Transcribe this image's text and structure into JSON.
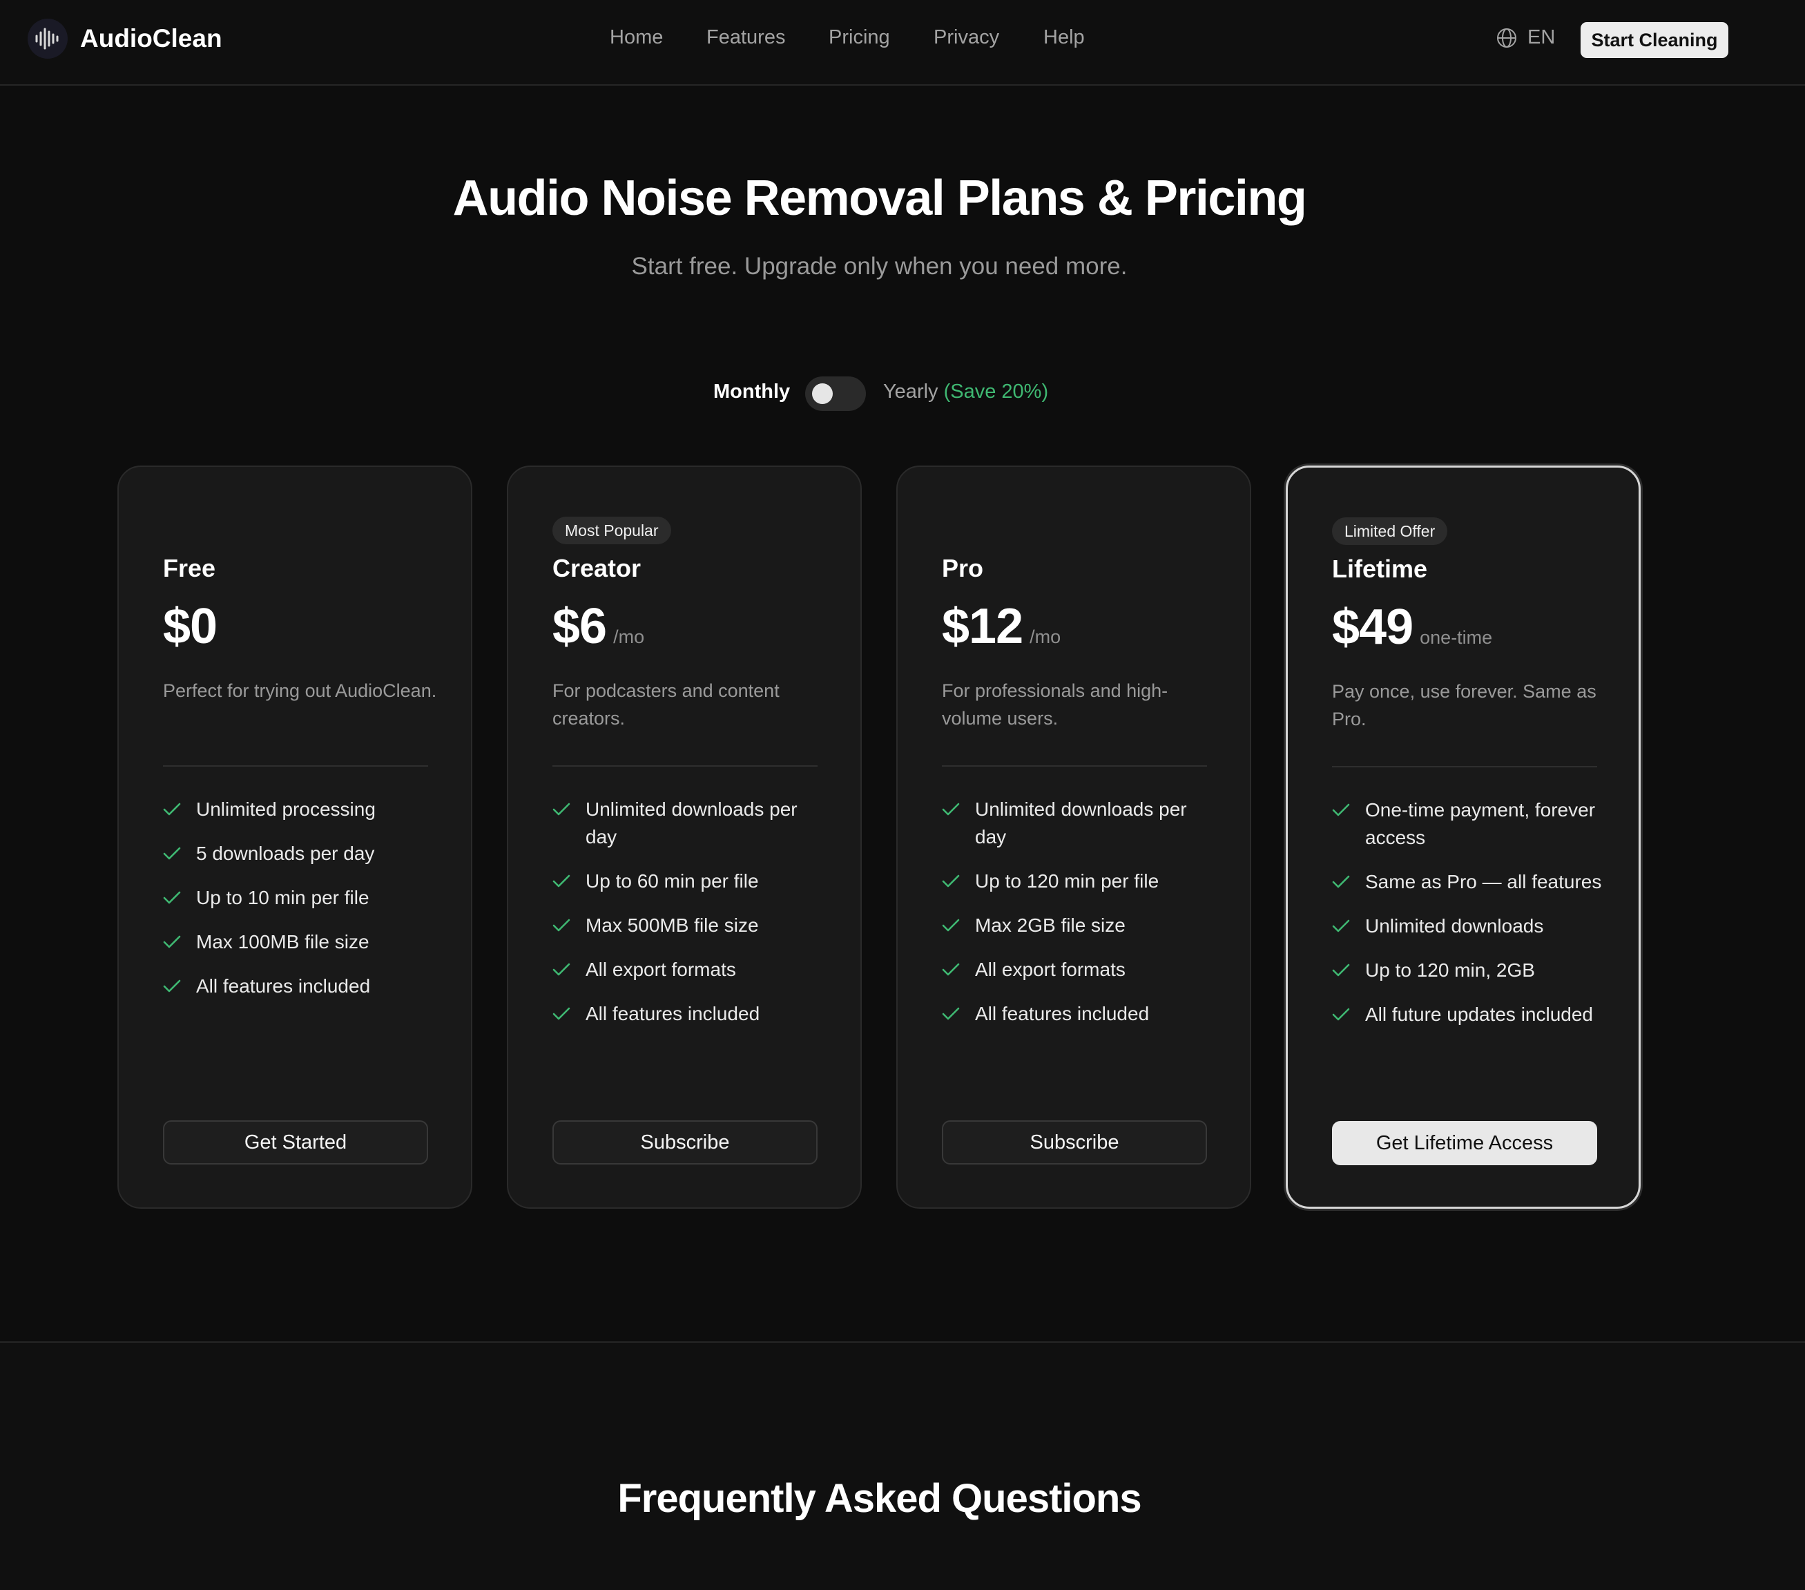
{
  "header": {
    "brand": "AudioClean",
    "nav": [
      "Home",
      "Features",
      "Pricing",
      "Privacy",
      "Help"
    ],
    "language": "EN",
    "cta": "Start Cleaning"
  },
  "hero": {
    "title": "Audio Noise Removal Plans & Pricing",
    "subtitle": "Start free. Upgrade only when you need more."
  },
  "billing": {
    "monthly_label": "Monthly",
    "yearly_label": "Yearly",
    "save_label": "(Save 20%)",
    "yearly_selected": false
  },
  "colors": {
    "accent_green": "#3fb872",
    "background": "#0d0d0d",
    "card": "#191919"
  },
  "plans": [
    {
      "badge": "",
      "name": "Free",
      "price": "$0",
      "period": "",
      "description": "Perfect for trying out AudioClean.",
      "features": [
        "Unlimited processing",
        "5 downloads per day",
        "Up to 10 min per file",
        "Max 100MB file size",
        "All features included"
      ],
      "button": "Get Started"
    },
    {
      "badge": "Most Popular",
      "name": "Creator",
      "price": "$6",
      "period": "/mo",
      "description": "For podcasters and content creators.",
      "features": [
        "Unlimited downloads per day",
        "Up to 60 min per file",
        "Max 500MB file size",
        "All export formats",
        "All features included"
      ],
      "button": "Subscribe"
    },
    {
      "badge": "",
      "name": "Pro",
      "price": "$12",
      "period": "/mo",
      "description": "For professionals and high-volume users.",
      "features": [
        "Unlimited downloads per day",
        "Up to 120 min per file",
        "Max 2GB file size",
        "All export formats",
        "All features included"
      ],
      "button": "Subscribe"
    },
    {
      "badge": "Limited Offer",
      "name": "Lifetime",
      "price": "$49",
      "period": "one-time",
      "description": "Pay once, use forever. Same as Pro.",
      "features": [
        "One-time payment, forever access",
        "Same as Pro — all features",
        "Unlimited downloads",
        "Up to 120 min, 2GB",
        "All future updates included"
      ],
      "button": "Get Lifetime Access"
    }
  ],
  "faq": {
    "title": "Frequently Asked Questions"
  }
}
